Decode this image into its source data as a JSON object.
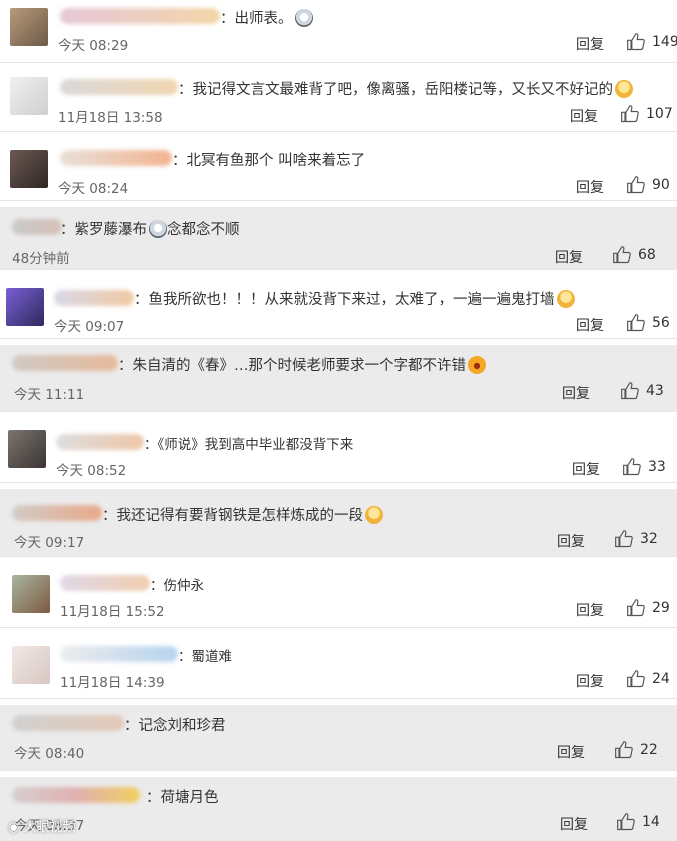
{
  "reply_label": "回复",
  "comments": [
    {
      "text": "：出师表。",
      "emoji": "face",
      "time": "今天 08:29",
      "likes": "149"
    },
    {
      "text": "：我记得文言文最难背了吧，像离骚，岳阳楼记等，又长又不好记的",
      "emoji": "lol",
      "time": "11月18日 13:58",
      "likes": "107"
    },
    {
      "text": "：北冥有鱼那个 叫啥来着忘了",
      "emoji": "",
      "time": "今天 08:24",
      "likes": "90"
    },
    {
      "text": "：紫罗藤瀑布",
      "text2": "念都念不顺",
      "emoji": "face",
      "time": "48分钟前",
      "likes": "68"
    },
    {
      "text": "：鱼我所欲也！！！从来就没背下来过，太难了，一遍一遍鬼打墙",
      "emoji": "lol",
      "time": "今天 09:07",
      "likes": "56"
    },
    {
      "text": "：朱自清的《春》…那个时候老师要求一个字都不许错",
      "emoji": "shock",
      "time": "今天 11:11",
      "likes": "43"
    },
    {
      "text": "：《师说》我到高中毕业都没背下来",
      "emoji": "",
      "time": "今天 08:52",
      "likes": "33"
    },
    {
      "text": "：我还记得有要背钢铁是怎样炼成的一段",
      "emoji": "lol",
      "time": "今天 09:17",
      "likes": "32"
    },
    {
      "text": "：伤仲永",
      "emoji": "",
      "time": "11月18日 15:52",
      "likes": "29"
    },
    {
      "text": "：蜀道难",
      "emoji": "",
      "time": "11月18日 14:39",
      "likes": "24"
    },
    {
      "text": "：记念刘和珍君",
      "emoji": "",
      "time": "今天 08:40",
      "likes": "22"
    },
    {
      "text": "：荷塘月色",
      "emoji": "",
      "time": "今天 08:37",
      "likes": "14"
    }
  ],
  "watermark": "大眼视频"
}
